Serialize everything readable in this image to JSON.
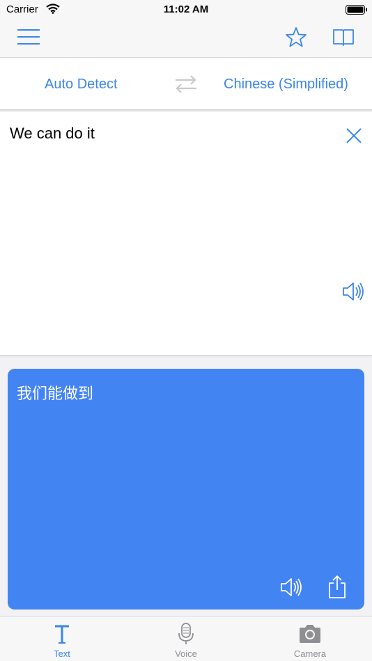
{
  "status_bar": {
    "carrier": "Carrier",
    "time": "11:02 AM"
  },
  "nav": {
    "menu_icon": "hamburger-menu-icon",
    "favorites_icon": "star-icon",
    "dictionary_icon": "book-icon"
  },
  "languages": {
    "source": "Auto Detect",
    "target": "Chinese (Simplified)",
    "swap_icon": "swap-arrows-icon"
  },
  "input": {
    "text": "We can do it"
  },
  "output": {
    "text": "我们能做到"
  },
  "tabs": [
    {
      "label": "Text",
      "icon": "text-t-icon",
      "active": true
    },
    {
      "label": "Voice",
      "icon": "microphone-icon",
      "active": false
    },
    {
      "label": "Camera",
      "icon": "camera-icon",
      "active": false
    }
  ],
  "colors": {
    "accent": "#3a86e6",
    "result_bg": "#4384f3",
    "inactive": "#8e8e93"
  }
}
